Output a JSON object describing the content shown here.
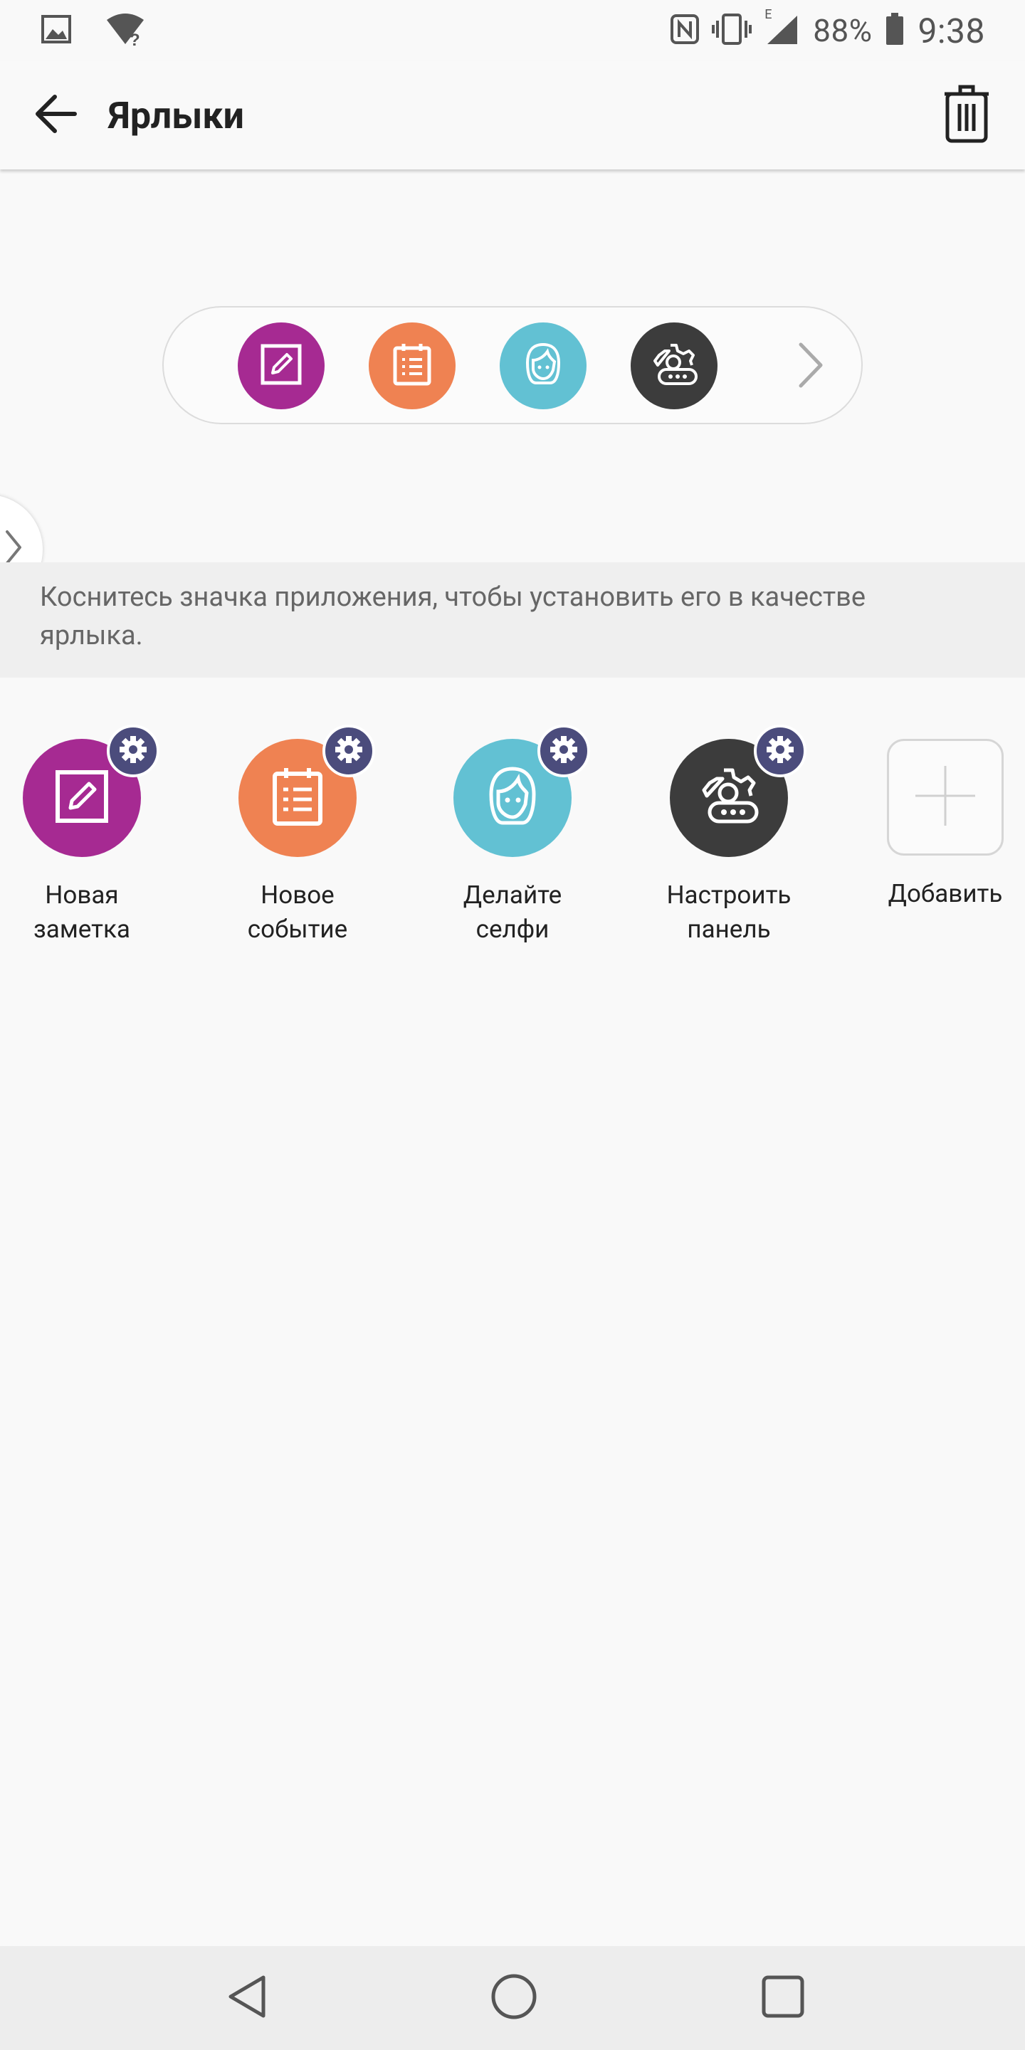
{
  "status_bar": {
    "battery_percent": "88%",
    "time": "9:38",
    "network_type": "E",
    "icons": [
      "gallery-icon",
      "wifi-unknown-icon",
      "nfc-icon",
      "vibrate-icon",
      "signal-icon",
      "battery-icon"
    ]
  },
  "app_bar": {
    "title": "Ярлыки",
    "back_icon": "arrow-back-icon",
    "delete_icon": "trash-icon"
  },
  "preview": {
    "icons": [
      {
        "name": "note-icon",
        "color": "#a62a92"
      },
      {
        "name": "calendar-icon",
        "color": "#ef8252"
      },
      {
        "name": "selfie-icon",
        "color": "#62c1d3"
      },
      {
        "name": "settings-panel-icon",
        "color": "#3c3c3c"
      }
    ],
    "next_icon": "chevron-right-icon"
  },
  "hint": "Коснитесь значка приложения, чтобы установить его в качестве ярлыка.",
  "shortcuts": [
    {
      "label": "Новая заметка",
      "color": "#a62a92"
    },
    {
      "label": "Новое событие",
      "color": "#ef8252"
    },
    {
      "label": "Делайте селфи",
      "color": "#62c1d3"
    },
    {
      "label": "Настроить панель",
      "color": "#3c3c3c"
    }
  ],
  "add_button": {
    "label": "Добавить"
  },
  "gear_badge_color": "#4b4c7c",
  "nav_bar": {
    "icons": [
      "back-triangle-icon",
      "home-circle-icon",
      "recents-square-icon"
    ]
  }
}
